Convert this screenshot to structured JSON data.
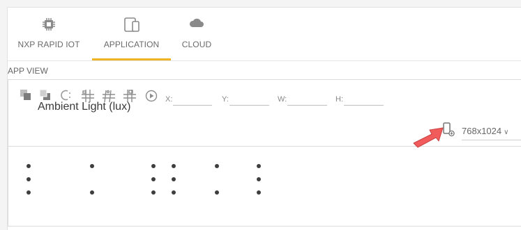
{
  "tabs": [
    {
      "label": "NXP RAPID IOT",
      "icon": "chip-icon",
      "active": false
    },
    {
      "label": "APPLICATION",
      "icon": "devices-icon",
      "active": true
    },
    {
      "label": "CLOUD",
      "icon": "cloud-icon",
      "active": false
    }
  ],
  "app_view": {
    "title": "APP VIEW",
    "toolbar": {
      "tools": [
        "bring-forward-icon",
        "send-backward-icon",
        "rotate-icon",
        "align-grid-icon",
        "distribute-grid-icon",
        "snap-grid-icon",
        "play-icon"
      ],
      "coords": {
        "x_label": "X:",
        "y_label": "Y:",
        "w_label": "W:",
        "h_label": "H:",
        "x": "",
        "y": "",
        "w": "",
        "h": ""
      }
    },
    "device_icon": "device-preview-icon",
    "resolution": "768x1024",
    "widget_label": "Ambient Light (lux)"
  },
  "colors": {
    "accent": "#f0b323",
    "arrow": "#ef5350"
  }
}
